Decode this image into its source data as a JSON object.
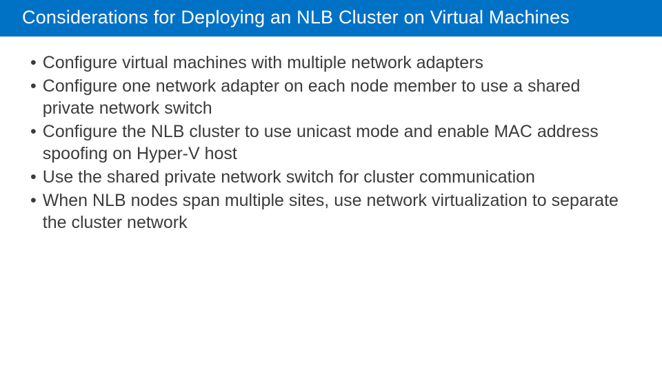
{
  "title": "Considerations for Deploying an NLB Cluster on Virtual Machines",
  "bullets": [
    "Configure virtual machines with multiple network adapters",
    "Configure one network adapter on each node member to use a shared private network switch",
    "Configure the NLB cluster to use unicast mode and enable MAC address spoofing on Hyper-V host",
    "Use the shared private network switch for cluster communication",
    "When NLB nodes span multiple sites, use network virtualization to separate the cluster network"
  ]
}
